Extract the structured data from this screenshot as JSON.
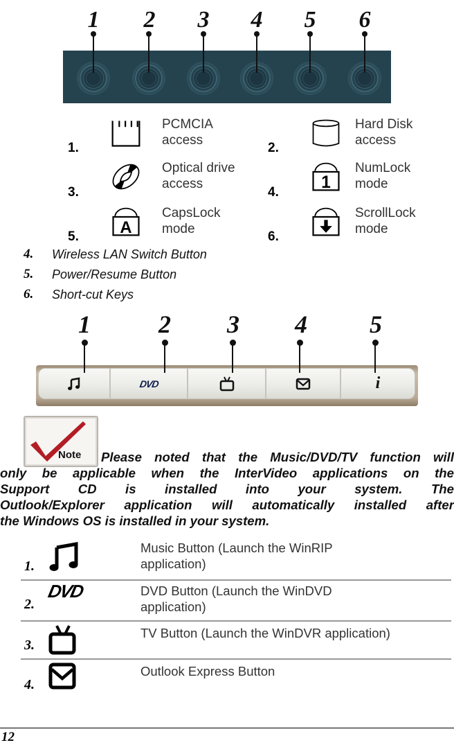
{
  "figure_led": {
    "callouts": [
      "1",
      "2",
      "3",
      "4",
      "5",
      "6"
    ],
    "panel_color": "#24434f"
  },
  "led_legend": [
    {
      "num": "1.",
      "icon": "pcmcia-icon",
      "label_line1": "PCMCIA",
      "label_line2": "access"
    },
    {
      "num": "2.",
      "icon": "hard-disk-icon",
      "label_line1": "Hard Disk",
      "label_line2": "access"
    },
    {
      "num": "3.",
      "icon": "optical-drive-icon",
      "label_line1": "Optical drive",
      "label_line2": "access"
    },
    {
      "num": "4.",
      "icon": "numlock-icon",
      "label_line1": "NumLock",
      "label_line2": "mode"
    },
    {
      "num": "5.",
      "icon": "capslock-icon",
      "label_line1": "CapsLock",
      "label_line2": "mode"
    },
    {
      "num": "6.",
      "icon": "scrolllock-icon",
      "label_line1": "ScrollLock",
      "label_line2": "mode"
    }
  ],
  "item_list": [
    {
      "num": "4.",
      "text": "Wireless LAN Switch Button"
    },
    {
      "num": "5.",
      "text": "Power/Resume Button"
    },
    {
      "num": "6.",
      "text": "Short-cut Keys"
    }
  ],
  "figure_shortcut": {
    "callouts": [
      "1",
      "2",
      "3",
      "4",
      "5"
    ],
    "buttons": [
      {
        "icon": "music-note-icon"
      },
      {
        "icon": "dvd-logo-icon",
        "text": "DVD"
      },
      {
        "icon": "tv-icon"
      },
      {
        "icon": "mail-icon"
      },
      {
        "icon": "info-icon",
        "text": "i"
      }
    ]
  },
  "note": {
    "badge_label": "Note",
    "lines": [
      "Please noted that the Music/DVD/TV function will",
      "only be applicable when the InterVideo applications on the",
      "Support CD is installed into your system. The",
      "Outlook/Explorer application will automatically installed after",
      "the Windows OS is installed in your system."
    ]
  },
  "button_table": [
    {
      "num": "1.",
      "icon": "music-note-icon",
      "line1": "Music Button (Launch the WinRIP",
      "line2": "application)"
    },
    {
      "num": "2.",
      "icon": "dvd-logo-icon",
      "icon_text": "DVD",
      "line1": "DVD Button (Launch the WinDVD",
      "line2": "application)"
    },
    {
      "num": "3.",
      "icon": "tv-icon",
      "line1": "TV Button (Launch the WinDVR application)",
      "line2": ""
    },
    {
      "num": "4.",
      "icon": "mail-icon",
      "line1": "Outlook Express Button",
      "line2": ""
    }
  ],
  "footer": {
    "page_number": "12"
  }
}
